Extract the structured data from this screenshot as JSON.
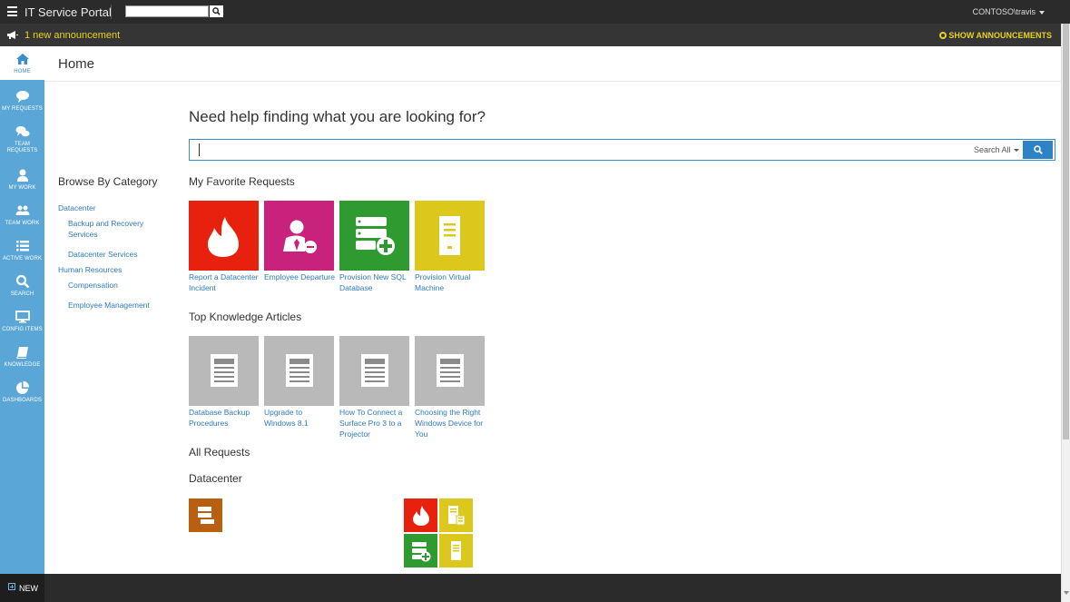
{
  "app": {
    "title": "IT Service Portal",
    "user": "CONTOSO\\travis"
  },
  "announcement": {
    "text": "1 new announcement",
    "show_label": "SHOW ANNOUNCEMENTS"
  },
  "nav": {
    "items": [
      {
        "label": "HOME",
        "icon": "home-icon",
        "active": true
      },
      {
        "label": "MY REQUESTS",
        "icon": "chat-bubble-icon"
      },
      {
        "label": "TEAM REQUESTS",
        "icon": "chat-bubbles-icon"
      },
      {
        "label": "MY WORK",
        "icon": "person-icon"
      },
      {
        "label": "TEAM WORK",
        "icon": "people-icon"
      },
      {
        "label": "ACTIVE WORK",
        "icon": "list-icon"
      },
      {
        "label": "SEARCH",
        "icon": "search-icon"
      },
      {
        "label": "CONFIG ITEMS",
        "icon": "monitor-icon"
      },
      {
        "label": "KNOWLEDGE",
        "icon": "book-icon"
      },
      {
        "label": "DASHBOARDS",
        "icon": "pie-chart-icon"
      }
    ],
    "new_label": "NEW"
  },
  "page": {
    "title": "Home"
  },
  "search": {
    "heading": "Need help finding what you are looking for?",
    "scope": "Search All"
  },
  "browse": {
    "title": "Browse By Category",
    "categories": [
      {
        "label": "Datacenter",
        "level": 0
      },
      {
        "label": "Backup and Recovery Services",
        "level": 1
      },
      {
        "label": "Datacenter Services",
        "level": 1
      },
      {
        "label": "Human Resources",
        "level": 0
      },
      {
        "label": "Compensation",
        "level": 1
      },
      {
        "label": "Employee Management",
        "level": 1
      }
    ]
  },
  "favorites": {
    "title": "My Favorite Requests",
    "items": [
      {
        "label": "Report a Datacenter Incident",
        "color": "#e8210f",
        "icon": "flame-icon"
      },
      {
        "label": "Employee Departure",
        "color": "#c9227c",
        "icon": "person-remove-icon"
      },
      {
        "label": "Provision New SQL Database",
        "color": "#2f9a2f",
        "icon": "server-add-icon"
      },
      {
        "label": "Provision Virtual Machine",
        "color": "#dcc81c",
        "icon": "server-tower-icon"
      }
    ]
  },
  "knowledge": {
    "title": "Top Knowledge Articles",
    "items": [
      {
        "label": "Database Backup Procedures",
        "color": "#b9b9b9",
        "icon": "article-icon"
      },
      {
        "label": "Upgrade to Windows 8.1",
        "color": "#b9b9b9",
        "icon": "article-icon"
      },
      {
        "label": "How To Connect a Surface Pro 3 to a Projector",
        "color": "#b9b9b9",
        "icon": "article-icon"
      },
      {
        "label": "Choosing the Right Windows Device for You",
        "color": "#b9b9b9",
        "icon": "article-icon"
      }
    ]
  },
  "all_requests": {
    "title": "All Requests",
    "group_title": "Datacenter",
    "tiles": [
      {
        "color": "#b8600f",
        "icon": "server-stack-icon"
      },
      {
        "color": "#e8210f",
        "icon": "flame-icon"
      },
      {
        "color": "#dcc81c",
        "icon": "server-tower-icon"
      },
      {
        "color": "#2f9a2f",
        "icon": "server-add-icon"
      },
      {
        "color": "#dcc81c",
        "icon": "server-tower-icon"
      }
    ]
  }
}
